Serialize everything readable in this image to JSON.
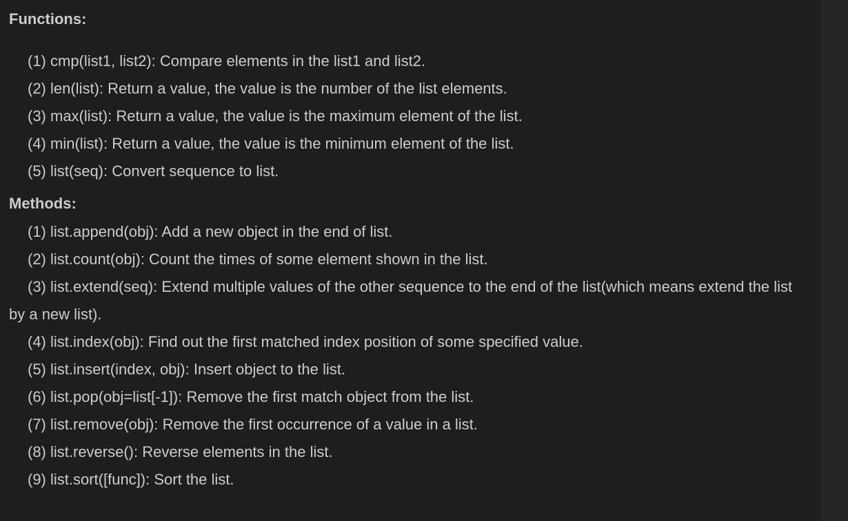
{
  "functions": {
    "heading": "Functions:",
    "items": [
      "(1) cmp(list1, list2): Compare elements in the list1 and list2.",
      "(2) len(list): Return a value, the value is the number of the list elements.",
      "(3) max(list): Return a value, the value is the maximum element of the list.",
      "(4) min(list): Return a value, the value is the minimum element of the list.",
      "(5) list(seq): Convert sequence to list."
    ]
  },
  "methods": {
    "heading": "Methods:",
    "items": [
      "(1) list.append(obj): Add a new object in the end of list.",
      "(2) list.count(obj): Count the times of some element shown in the list.",
      "(3) list.extend(seq): Extend multiple values of the other sequence to the end of the list(which means extend the list by a new list).",
      "(4) list.index(obj): Find out the first matched index position of some specified value.",
      "(5) list.insert(index, obj): Insert object to the list.",
      "(6) list.pop(obj=list[-1]): Remove the first match object from the list.",
      "(7) list.remove(obj): Remove the first occurrence of a value in a list.",
      "(8) list.reverse(): Reverse elements in the list.",
      "(9) list.sort([func]): Sort the list."
    ]
  }
}
